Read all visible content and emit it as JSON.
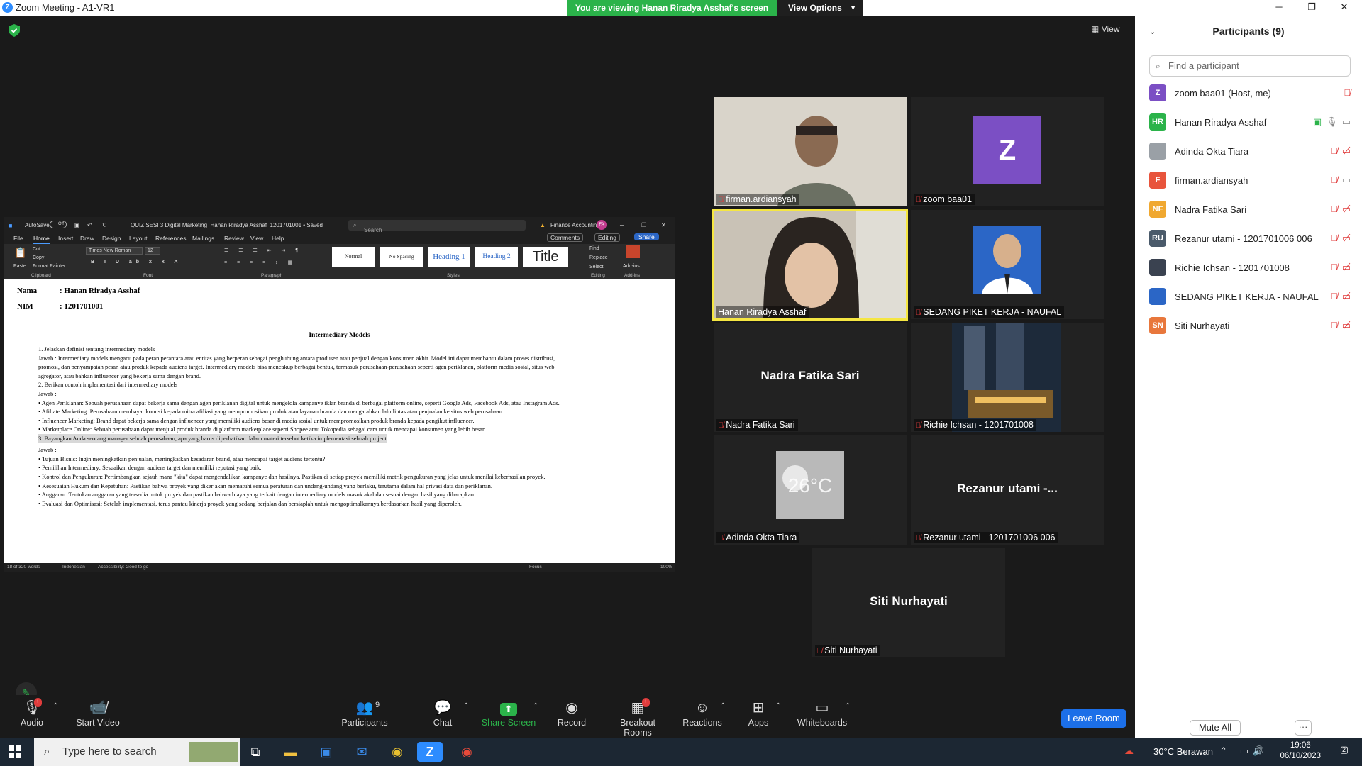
{
  "window": {
    "title": "Zoom Meeting - A1-VR1",
    "banner": "You are viewing Hanan Riradya Asshaf's screen",
    "view_options": "View Options",
    "view_label": "View"
  },
  "word": {
    "autosave": "AutoSave",
    "autosave_state": "Off",
    "doc_title": "QUIZ SESI 3 Digital Marketing_Hanan Riradya Asshaf_1201701001 • Saved",
    "search_placeholder": "Search",
    "account": "Finance Accounting",
    "account_initials": "FA",
    "tabs": [
      "File",
      "Home",
      "Insert",
      "Draw",
      "Design",
      "Layout",
      "References",
      "Mailings",
      "Review",
      "View",
      "Help"
    ],
    "comments": "Comments",
    "editing": "Editing",
    "share": "Share",
    "font_name": "Times New Roman",
    "font_size": "12",
    "clipboard": {
      "paste": "Paste",
      "cut": "Cut",
      "copy": "Copy",
      "format_painter": "Format Painter",
      "label": "Clipboard"
    },
    "group_labels": {
      "font": "Font",
      "paragraph": "Paragraph",
      "styles": "Styles",
      "editing": "Editing",
      "addins": "Add-ins"
    },
    "styles": [
      "Normal",
      "No Spacing",
      "Heading 1",
      "Heading 2",
      "Title"
    ],
    "editing_tools": {
      "find": "Find",
      "replace": "Replace",
      "select": "Select"
    },
    "addins_label": "Add-ins",
    "status": {
      "words": "18 of 320 words",
      "language": "Indonesian",
      "accessibility": "Accessibility: Good to go",
      "focus": "Focus",
      "zoom": "100%"
    }
  },
  "document": {
    "nama_label": "Nama",
    "nama_value": ": Hanan Riradya Asshaf",
    "nim_label": "NIM",
    "nim_value": ": 1201701001",
    "heading": "Intermediary Models",
    "lines": [
      "1.   Jelaskan definisi tentang intermediary models",
      "       Jawab : Intermediary models mengacu pada peran perantara atau entitas yang berperan sebagai penghubung antara produsen atau penjual dengan konsumen akhir. Model ini dapat membantu dalam proses distribusi,",
      "       promosi, dan penyampaian pesan atau produk kepada audiens target. Intermediary models bisa mencakup berbagai bentuk, termasuk perusahaan-perusahaan seperti agen periklanan, platform media sosial, situs web",
      "       agregator, atau bahkan influencer yang bekerja sama dengan brand.",
      "2.   Berikan contoh implementasi dari intermediary models",
      "       Jawab :",
      "•   Agen Periklanan: Sebuah perusahaan dapat bekerja sama dengan agen periklanan digital untuk mengelola kampanye iklan brandа di berbagai platform online, seperti Google Ads, Facebook Ads, atau Instagram Ads.",
      "•   Afiliate Marketing: Perusahaan membayar komisi kepada mitra afiliasi yang mempromosikan produk atau layanan brandа dan mengarahkan lalu lintas atau penjualan ke situs web perusahaan.",
      "•   Influencer Marketing: Brand dapat bekerja sama dengan influencer yang memiliki audiens besar di media sosial untuk mempromosikan produk brandа kepada pengikut influencer.",
      "•   Marketplace Online: Sebuah perusahaan dapat menjual produk brandа di platform marketplace seperti Shopee atau Tokopedia sebagai cara untuk mencapai konsumen yang lebih besar.",
      "3.   Bayangkan Anda seorang manager sebuah perusahaan, apa yang harus diperhatikan dalam materi tersebut ketika implementasi sebuah project",
      "       Jawab :",
      "•   Tujuan Bisnis: Ingin meningkatkan penjualan, meningkatkan kesadaran brand, atau mencapai target audiens tertentu?",
      "•   Pemilihan Intermediary: Sesuaikan dengan audiens target dan memiliki reputasi yang baik.",
      "•   Kontrol dan Pengukuran: Pertimbangkan sejauh mana \"kita\" dapat mengendalikan kampanye dan hasilnya. Pastikan di setiap proyek memiliki metrik pengukuran yang jelas untuk menilai keberhasilan proyek.",
      "•   Kesesuaian Hukum dan Kepatuhan: Pastikan bahwa proyek yang dikerjakan mematuhi semua peraturan dan undang-undang yang berlaku, terutama dalam hal privasi data dan periklanan.",
      "•   Anggaran: Tentukan anggaran yang tersedia untuk proyek dan pastikan bahwa biaya yang terkait dengan intermediary models masuk akal dan sesuai dengan hasil yang diharapkan.",
      "•   Evaluasi dan Optimisasi: Setelah implementasi, terus pantau kinerja proyek yang sedang berjalan dan bersiaplah untuk mengoptimalkannya berdasarkan hasil yang diperoleh."
    ]
  },
  "tiles": [
    {
      "label": "firman.ardiansyah",
      "kind": "video",
      "bg": "#cfcac0"
    },
    {
      "label": "zoom baa01",
      "kind": "avatar",
      "avatar_letter": "Z",
      "avatar_color": "#7b4fc4"
    },
    {
      "label": "Hanan Riradya Asshaf",
      "kind": "video",
      "bg": "#bfb8ae"
    },
    {
      "label": "SEDANG PIKET KERJA - NAUFAL",
      "kind": "photo"
    },
    {
      "label": "Nadra Fatika Sari",
      "kind": "name",
      "big_name": "Nadra Fatika Sari"
    },
    {
      "label": "Richie Ichsan - 1201701008",
      "kind": "photo"
    },
    {
      "label": "Adinda Okta Tiara",
      "kind": "photo",
      "photo_text": "26°C"
    },
    {
      "label": "Rezanur utami - 1201701006 006",
      "kind": "name",
      "big_name": "Rezanur utami -..."
    },
    {
      "label": "Siti Nurhayati",
      "kind": "name",
      "big_name": "Siti Nurhayati"
    }
  ],
  "toolbar": {
    "audio": "Audio",
    "start_video": "Start Video",
    "participants": "Participants",
    "participants_count": "9",
    "chat": "Chat",
    "share_screen": "Share Screen",
    "record": "Record",
    "breakout_rooms": "Breakout Rooms",
    "reactions": "Reactions",
    "apps": "Apps",
    "whiteboards": "Whiteboards",
    "leave": "Leave Room",
    "badge_audio": "!",
    "badge_breakout": "!"
  },
  "panel": {
    "title": "Participants (9)",
    "search_placeholder": "Find a participant",
    "mute_all": "Mute All",
    "more": "···",
    "participants": [
      {
        "initials": "Z",
        "name": "zoom baa01 (Host, me)",
        "color": "#7b4fc4"
      },
      {
        "initials": "HR",
        "name": "Hanan Riradya Asshaf",
        "color": "#2bb34a"
      },
      {
        "initials": "",
        "name": "Adinda Okta Tiara",
        "color": "#9aa0a6"
      },
      {
        "initials": "F",
        "name": "firman.ardiansyah",
        "color": "#e8543c"
      },
      {
        "initials": "NF",
        "name": "Nadra Fatika Sari",
        "color": "#f0a830"
      },
      {
        "initials": "RU",
        "name": "Rezanur utami - 1201701006 006",
        "color": "#4a5a6a"
      },
      {
        "initials": "",
        "name": "Richie Ichsan - 1201701008",
        "color": "#3a4250"
      },
      {
        "initials": "",
        "name": "SEDANG PIKET KERJA - NAUFAL",
        "color": "#2b66c6"
      },
      {
        "initials": "SN",
        "name": "Siti Nurhayati",
        "color": "#e8773c"
      }
    ]
  },
  "taskbar": {
    "search_placeholder": "Type here to search",
    "weather": "30°C  Berawan",
    "time": "19:06",
    "date": "06/10/2023",
    "notification_count": "2"
  }
}
